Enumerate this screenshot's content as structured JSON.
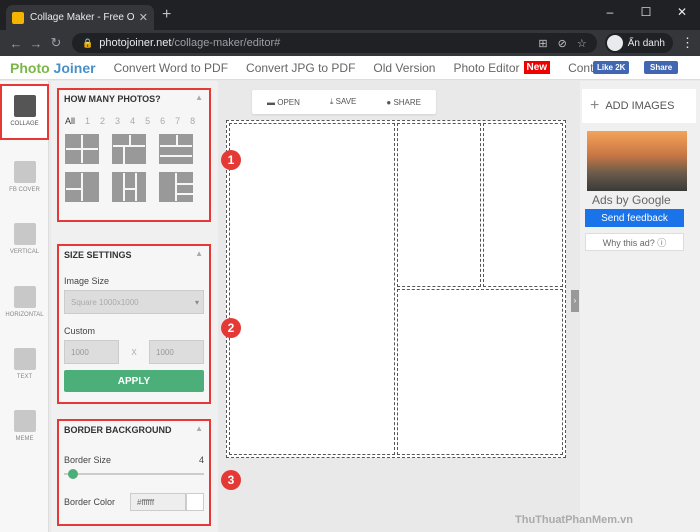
{
  "browser": {
    "tab_title": "Collage Maker - Free Online Photo Collage",
    "tab_close": "✕",
    "new_tab": "+",
    "url_host": "photojoiner.net",
    "url_path": "/collage-maker/editor#",
    "profile": "Ẩn danh"
  },
  "site_nav": {
    "logo_photo": "Photo",
    "logo_joiner": "Joiner",
    "links": [
      "Convert Word to PDF",
      "Convert JPG to PDF",
      "Old Version",
      "Photo Editor",
      "Contact ▾"
    ],
    "new_badge": "New",
    "fb_like": "Like 2K",
    "fb_share": "Share"
  },
  "tools": [
    "COLLAGE",
    "FB COVER",
    "VERTICAL",
    "HORIZONTAL",
    "TEXT",
    "MEME"
  ],
  "panel": {
    "photos": {
      "title": "HOW MANY PHOTOS?",
      "counts": [
        "All",
        "1",
        "2",
        "3",
        "4",
        "5",
        "6",
        "7",
        "8"
      ]
    },
    "size": {
      "title": "SIZE SETTINGS",
      "image_size_label": "Image Size",
      "image_size_value": "Square 1000x1000",
      "custom_label": "Custom",
      "width": "1000",
      "x": "X",
      "height": "1000",
      "apply": "APPLY"
    },
    "border": {
      "title": "BORDER BACKGROUND",
      "size_label": "Border Size",
      "size_value": "4",
      "color_label": "Border Color",
      "color_value": "#ffffff"
    }
  },
  "toolbar": {
    "open": "OPEN",
    "save": "SAVE",
    "share": "SHARE"
  },
  "right_panel": {
    "add_images": "ADD IMAGES",
    "ads_by": "Ads by Google",
    "feedback": "Send feedback",
    "why": "Why this ad? ⓘ"
  },
  "callouts": [
    "1",
    "2",
    "3"
  ],
  "watermark": "ThuThuatPhanMem.vn"
}
